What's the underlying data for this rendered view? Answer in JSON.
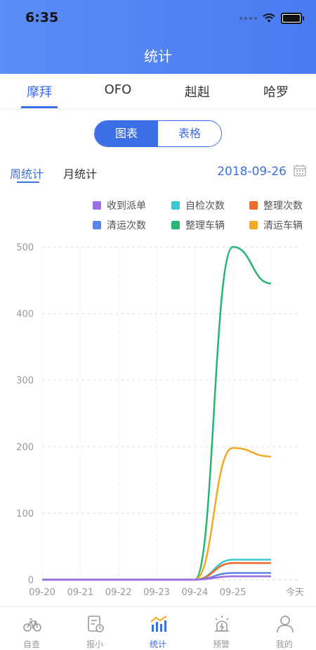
{
  "status_bar": {
    "time": "6:35"
  },
  "header": {
    "title": "统计"
  },
  "brand_tabs": [
    {
      "label": "摩拜",
      "active": true
    },
    {
      "label": "OFO",
      "active": false
    },
    {
      "label": "赳赳",
      "active": false
    },
    {
      "label": "哈罗",
      "active": false
    }
  ],
  "view_toggle": {
    "chart_label": "图表",
    "table_label": "表格",
    "selected": "图表"
  },
  "period_tabs": {
    "week_label": "周统计",
    "month_label": "月统计",
    "selected": "周统计"
  },
  "date": "2018-09-26",
  "legend": [
    {
      "name": "收到派单",
      "color": "#9b6ee6"
    },
    {
      "name": "自检次数",
      "color": "#3ec8d0"
    },
    {
      "name": "整理次数",
      "color": "#ef6a2b"
    },
    {
      "name": "清运次数",
      "color": "#5b84e8"
    },
    {
      "name": "整理车辆",
      "color": "#26b574"
    },
    {
      "name": "清运车辆",
      "color": "#f2aa24"
    }
  ],
  "chart_data": {
    "type": "line",
    "categories": [
      "09-20",
      "09-21",
      "09-22",
      "09-23",
      "09-24",
      "09-25",
      "今天"
    ],
    "ylim": [
      0,
      500
    ],
    "yticks": [
      0,
      100,
      200,
      300,
      400,
      500
    ],
    "grid": true,
    "legend_position": "top-right",
    "series": [
      {
        "name": "收到派单",
        "values": [
          0,
          0,
          0,
          0,
          0,
          5,
          5
        ]
      },
      {
        "name": "自检次数",
        "values": [
          0,
          0,
          0,
          0,
          0,
          30,
          30
        ]
      },
      {
        "name": "整理次数",
        "values": [
          0,
          0,
          0,
          0,
          0,
          25,
          25
        ]
      },
      {
        "name": "清运次数",
        "values": [
          0,
          0,
          0,
          0,
          0,
          10,
          10
        ]
      },
      {
        "name": "整理车辆",
        "values": [
          0,
          0,
          0,
          0,
          0,
          500,
          445
        ]
      },
      {
        "name": "清运车辆",
        "values": [
          0,
          0,
          0,
          0,
          0,
          198,
          185
        ]
      }
    ]
  },
  "tabbar": [
    {
      "label": "自查",
      "icon": "bike-icon",
      "active": false
    },
    {
      "label": "报小",
      "icon": "report-icon",
      "active": false
    },
    {
      "label": "统计",
      "icon": "stats-icon",
      "active": true
    },
    {
      "label": "预警",
      "icon": "warning-icon",
      "active": false
    },
    {
      "label": "我的",
      "icon": "user-icon",
      "active": false
    }
  ]
}
